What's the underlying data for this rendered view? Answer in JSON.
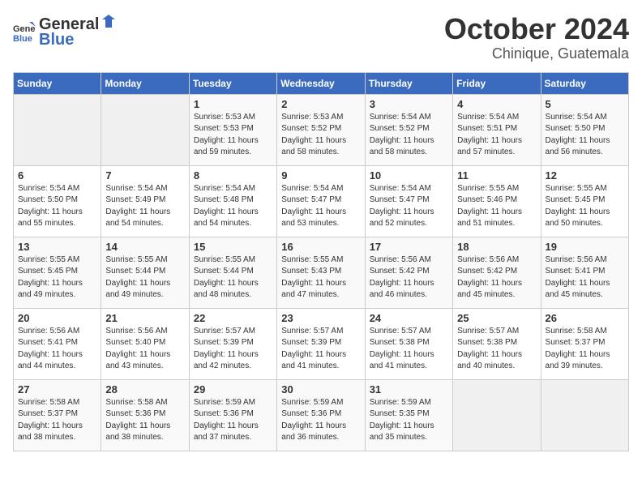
{
  "header": {
    "logo_general": "General",
    "logo_blue": "Blue",
    "month": "October 2024",
    "location": "Chinique, Guatemala"
  },
  "weekdays": [
    "Sunday",
    "Monday",
    "Tuesday",
    "Wednesday",
    "Thursday",
    "Friday",
    "Saturday"
  ],
  "weeks": [
    [
      {
        "day": "",
        "info": ""
      },
      {
        "day": "",
        "info": ""
      },
      {
        "day": "1",
        "info": "Sunrise: 5:53 AM\nSunset: 5:53 PM\nDaylight: 11 hours\nand 59 minutes."
      },
      {
        "day": "2",
        "info": "Sunrise: 5:53 AM\nSunset: 5:52 PM\nDaylight: 11 hours\nand 58 minutes."
      },
      {
        "day": "3",
        "info": "Sunrise: 5:54 AM\nSunset: 5:52 PM\nDaylight: 11 hours\nand 58 minutes."
      },
      {
        "day": "4",
        "info": "Sunrise: 5:54 AM\nSunset: 5:51 PM\nDaylight: 11 hours\nand 57 minutes."
      },
      {
        "day": "5",
        "info": "Sunrise: 5:54 AM\nSunset: 5:50 PM\nDaylight: 11 hours\nand 56 minutes."
      }
    ],
    [
      {
        "day": "6",
        "info": "Sunrise: 5:54 AM\nSunset: 5:50 PM\nDaylight: 11 hours\nand 55 minutes."
      },
      {
        "day": "7",
        "info": "Sunrise: 5:54 AM\nSunset: 5:49 PM\nDaylight: 11 hours\nand 54 minutes."
      },
      {
        "day": "8",
        "info": "Sunrise: 5:54 AM\nSunset: 5:48 PM\nDaylight: 11 hours\nand 54 minutes."
      },
      {
        "day": "9",
        "info": "Sunrise: 5:54 AM\nSunset: 5:47 PM\nDaylight: 11 hours\nand 53 minutes."
      },
      {
        "day": "10",
        "info": "Sunrise: 5:54 AM\nSunset: 5:47 PM\nDaylight: 11 hours\nand 52 minutes."
      },
      {
        "day": "11",
        "info": "Sunrise: 5:55 AM\nSunset: 5:46 PM\nDaylight: 11 hours\nand 51 minutes."
      },
      {
        "day": "12",
        "info": "Sunrise: 5:55 AM\nSunset: 5:45 PM\nDaylight: 11 hours\nand 50 minutes."
      }
    ],
    [
      {
        "day": "13",
        "info": "Sunrise: 5:55 AM\nSunset: 5:45 PM\nDaylight: 11 hours\nand 49 minutes."
      },
      {
        "day": "14",
        "info": "Sunrise: 5:55 AM\nSunset: 5:44 PM\nDaylight: 11 hours\nand 49 minutes."
      },
      {
        "day": "15",
        "info": "Sunrise: 5:55 AM\nSunset: 5:44 PM\nDaylight: 11 hours\nand 48 minutes."
      },
      {
        "day": "16",
        "info": "Sunrise: 5:55 AM\nSunset: 5:43 PM\nDaylight: 11 hours\nand 47 minutes."
      },
      {
        "day": "17",
        "info": "Sunrise: 5:56 AM\nSunset: 5:42 PM\nDaylight: 11 hours\nand 46 minutes."
      },
      {
        "day": "18",
        "info": "Sunrise: 5:56 AM\nSunset: 5:42 PM\nDaylight: 11 hours\nand 45 minutes."
      },
      {
        "day": "19",
        "info": "Sunrise: 5:56 AM\nSunset: 5:41 PM\nDaylight: 11 hours\nand 45 minutes."
      }
    ],
    [
      {
        "day": "20",
        "info": "Sunrise: 5:56 AM\nSunset: 5:41 PM\nDaylight: 11 hours\nand 44 minutes."
      },
      {
        "day": "21",
        "info": "Sunrise: 5:56 AM\nSunset: 5:40 PM\nDaylight: 11 hours\nand 43 minutes."
      },
      {
        "day": "22",
        "info": "Sunrise: 5:57 AM\nSunset: 5:39 PM\nDaylight: 11 hours\nand 42 minutes."
      },
      {
        "day": "23",
        "info": "Sunrise: 5:57 AM\nSunset: 5:39 PM\nDaylight: 11 hours\nand 41 minutes."
      },
      {
        "day": "24",
        "info": "Sunrise: 5:57 AM\nSunset: 5:38 PM\nDaylight: 11 hours\nand 41 minutes."
      },
      {
        "day": "25",
        "info": "Sunrise: 5:57 AM\nSunset: 5:38 PM\nDaylight: 11 hours\nand 40 minutes."
      },
      {
        "day": "26",
        "info": "Sunrise: 5:58 AM\nSunset: 5:37 PM\nDaylight: 11 hours\nand 39 minutes."
      }
    ],
    [
      {
        "day": "27",
        "info": "Sunrise: 5:58 AM\nSunset: 5:37 PM\nDaylight: 11 hours\nand 38 minutes."
      },
      {
        "day": "28",
        "info": "Sunrise: 5:58 AM\nSunset: 5:36 PM\nDaylight: 11 hours\nand 38 minutes."
      },
      {
        "day": "29",
        "info": "Sunrise: 5:59 AM\nSunset: 5:36 PM\nDaylight: 11 hours\nand 37 minutes."
      },
      {
        "day": "30",
        "info": "Sunrise: 5:59 AM\nSunset: 5:36 PM\nDaylight: 11 hours\nand 36 minutes."
      },
      {
        "day": "31",
        "info": "Sunrise: 5:59 AM\nSunset: 5:35 PM\nDaylight: 11 hours\nand 35 minutes."
      },
      {
        "day": "",
        "info": ""
      },
      {
        "day": "",
        "info": ""
      }
    ]
  ]
}
